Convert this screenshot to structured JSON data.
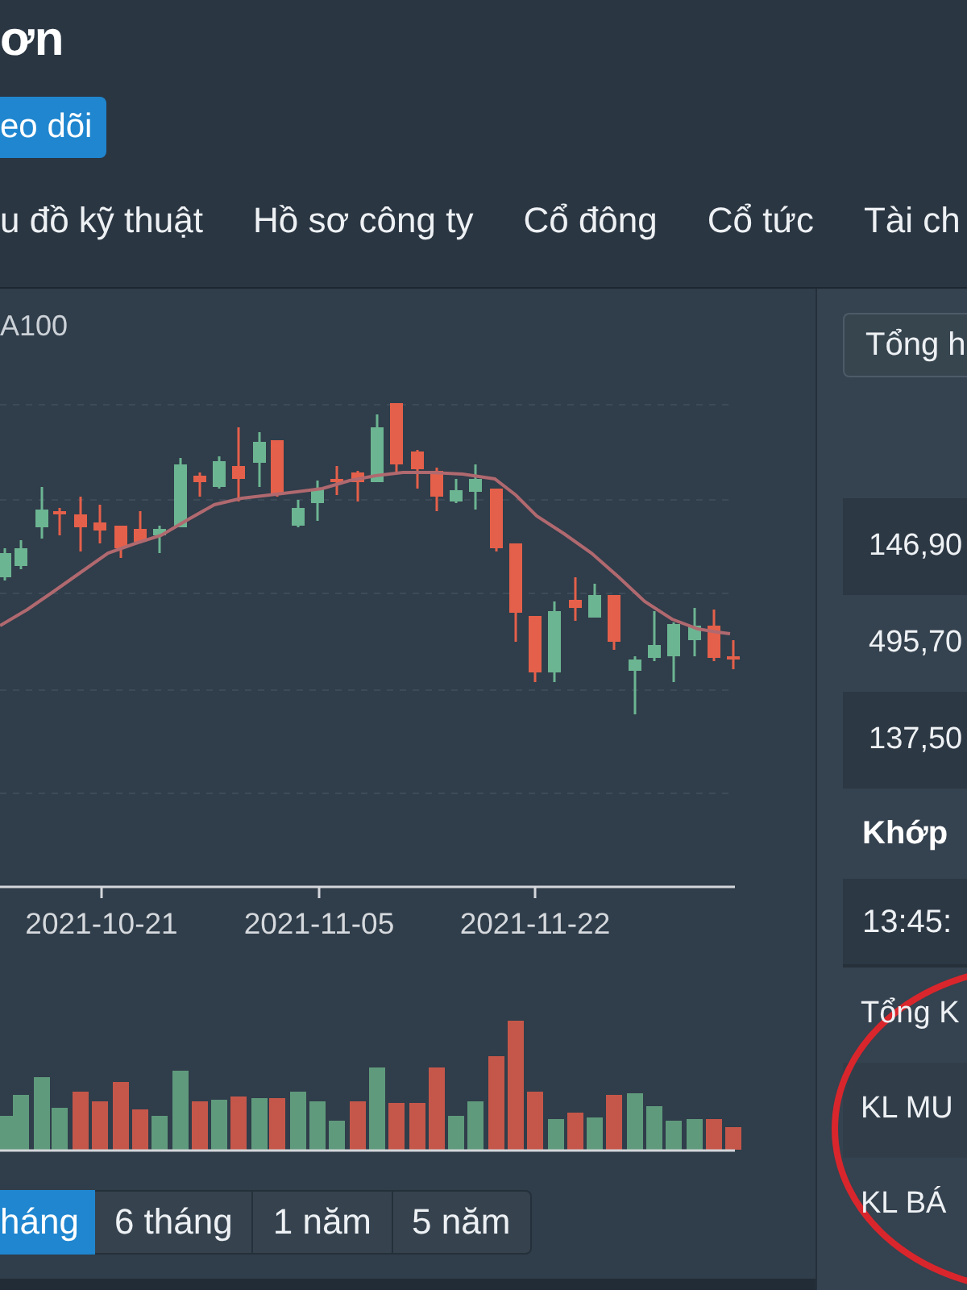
{
  "header": {
    "title": "ơn",
    "follow_button": "eo dõi"
  },
  "tabs": [
    {
      "label": "u đồ kỹ thuật"
    },
    {
      "label": "Hồ sơ công ty"
    },
    {
      "label": "Cổ đông"
    },
    {
      "label": "Cổ tức"
    },
    {
      "label": "Tài ch"
    }
  ],
  "chart": {
    "legend": "A100",
    "date_labels": [
      "2021-10-21",
      "2021-11-05",
      "2021-11-22"
    ]
  },
  "periods": [
    {
      "label": "háng",
      "selected": true
    },
    {
      "label": "6 tháng",
      "selected": false
    },
    {
      "label": "1 năm",
      "selected": false
    },
    {
      "label": "5 năm",
      "selected": false
    }
  ],
  "summary": {
    "selector": "Tổng h",
    "values": [
      "146,90",
      "495,70",
      "137,50"
    ],
    "section_title": "Khớp",
    "time": "13:45:",
    "rows": [
      "Tổng K",
      "KL MU",
      "KL BÁ"
    ]
  }
}
